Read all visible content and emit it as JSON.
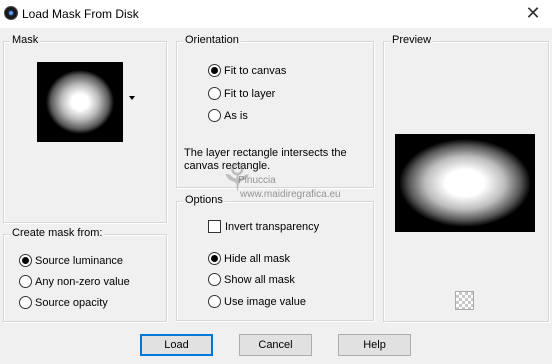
{
  "window": {
    "title": "Load Mask From Disk",
    "close_glyph": "✕"
  },
  "mask": {
    "group_label": "Mask",
    "icon": "dropdown-arrow-icon"
  },
  "create_mask_from": {
    "group_label": "Create mask from:",
    "options": [
      {
        "label": "Source luminance",
        "checked": true
      },
      {
        "label": "Any non-zero value",
        "checked": false
      },
      {
        "label": "Source opacity",
        "checked": false
      }
    ]
  },
  "orientation": {
    "group_label": "Orientation",
    "options": [
      {
        "label": "Fit to canvas",
        "checked": true
      },
      {
        "label": "Fit to layer",
        "checked": false
      },
      {
        "label": "As is",
        "checked": false
      }
    ],
    "info": "The layer rectangle intersects the canvas rectangle."
  },
  "options": {
    "group_label": "Options",
    "invert_transparency": {
      "label": "Invert transparency",
      "checked": false
    },
    "radios": [
      {
        "label": "Hide all mask",
        "checked": true
      },
      {
        "label": "Show all mask",
        "checked": false
      },
      {
        "label": "Use image value",
        "checked": false
      }
    ]
  },
  "preview": {
    "group_label": "Preview",
    "icon": "checkerboard-icon"
  },
  "buttons": {
    "load": "Load",
    "cancel": "Cancel",
    "help": "Help"
  },
  "watermark": {
    "name": "Pinuccia",
    "site": "www.maidiregrafica.eu"
  }
}
